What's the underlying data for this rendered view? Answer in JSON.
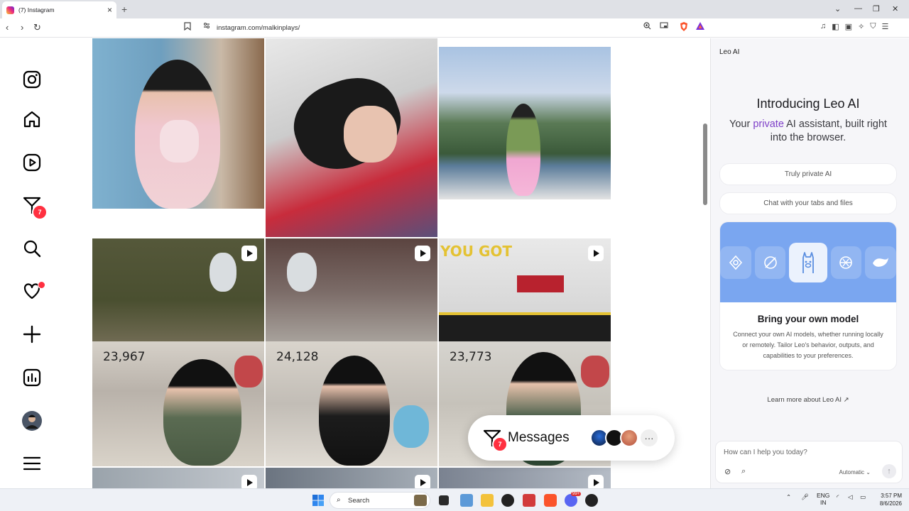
{
  "browser": {
    "tab_title": "(7) Instagram",
    "url": "instagram.com/malkinplays/",
    "new_tab": "+",
    "close": "×"
  },
  "instagram": {
    "notifications_badge": "7",
    "view_counts": [
      "23,967",
      "24,128",
      "23,773"
    ],
    "messages": {
      "label": "Messages",
      "badge": "7",
      "more": "···"
    }
  },
  "leo": {
    "header": "Leo AI",
    "title": "Introducing Leo AI",
    "subtitle_before": "Your ",
    "subtitle_accent": "private",
    "subtitle_after": " AI assistant, built right into the browser.",
    "cards": [
      "Truly private AI",
      "Chat with your tabs and files"
    ],
    "model_card": {
      "title": "Bring your own model",
      "description": "Connect your own AI models, whether running locally or remotely. Tailor Leo's behavior, outputs, and capabilities to your preferences."
    },
    "learn_more": "Learn more about Leo AI",
    "input_placeholder": "How can I help you today?",
    "mode": "Automatic"
  },
  "taskbar": {
    "search_label": "Search",
    "lang": "ENG",
    "region": "IN",
    "time": "3:57 PM",
    "date": "8/6/2026",
    "discord_badge": "99+"
  },
  "colors": {
    "accent_leo": "#7e3fc8",
    "ig_badge": "#ff3040",
    "leo_hero": "#7aa6f0"
  }
}
